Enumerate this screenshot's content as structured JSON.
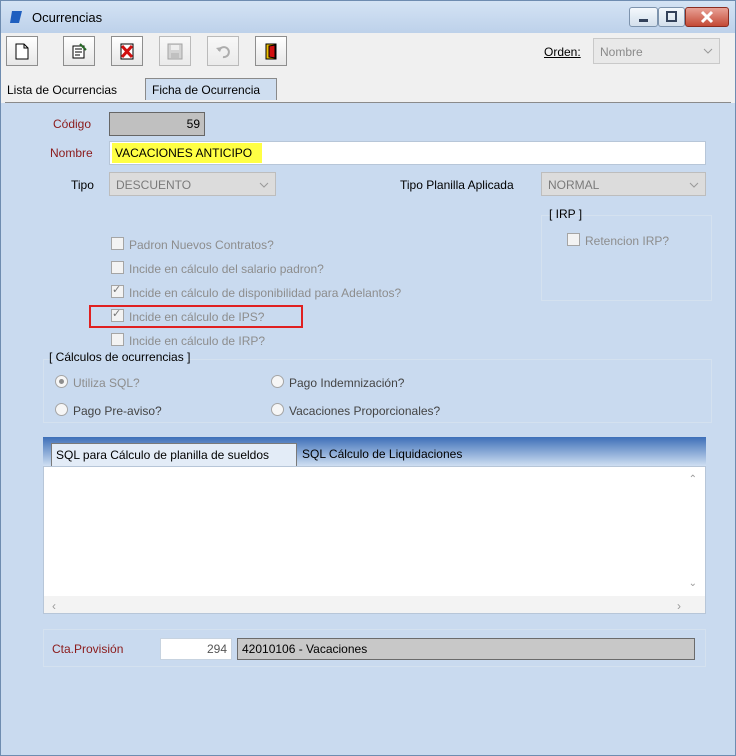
{
  "window": {
    "title": "Ocurrencias",
    "accent": "#1f5fbf"
  },
  "toolbar": {
    "buttons": [
      "new-document-icon",
      "edit-icon",
      "delete-icon",
      "save-icon",
      "undo-icon",
      "exit-icon"
    ],
    "orden_label": "Orden:",
    "orden_value": "Nombre"
  },
  "tabs": {
    "lista": "Lista de Ocurrencias",
    "ficha": "Ficha de Ocurrencia"
  },
  "form": {
    "codigo_label": "Código",
    "codigo_value": "59",
    "nombre_label": "Nombre",
    "nombre_value": "VACACIONES ANTICIPO",
    "tipo_label": "Tipo",
    "tipo_value": "DESCUENTO",
    "tipo_planilla_label": "Tipo Planilla Aplicada",
    "tipo_planilla_value": "NORMAL"
  },
  "irp": {
    "group_title": "[ IRP ]",
    "retencion_label": "Retencion IRP?",
    "retencion_checked": false
  },
  "checks": [
    {
      "label": "Padron Nuevos Contratos?",
      "checked": false
    },
    {
      "label": "Incide en cálculo del salario padron?",
      "checked": false
    },
    {
      "label": "Incide en cálculo de disponibilidad para Adelantos?",
      "checked": true
    },
    {
      "label": "Incide en cálculo de IPS?",
      "checked": true
    },
    {
      "label": "Incide en cálculo de IRP?",
      "checked": false
    }
  ],
  "calculos": {
    "group_title": "[ Cálculos de ocurrencias ]",
    "utiliza_sql": "Utiliza SQL?",
    "pago_indemnizacion": "Pago Indemnización?",
    "pago_preaviso": "Pago Pre-aviso?",
    "vacaciones_proporcionales": "Vacaciones Proporcionales?",
    "selected": "Utiliza SQL?"
  },
  "sql_tabs": {
    "planilla": "SQL para Cálculo de planilla de sueldos",
    "liquidaciones": "SQL Cálculo de Liquidaciones",
    "content": ""
  },
  "cuenta": {
    "label": "Cta.Provisión",
    "number": "294",
    "description": "42010106 - Vacaciones"
  }
}
